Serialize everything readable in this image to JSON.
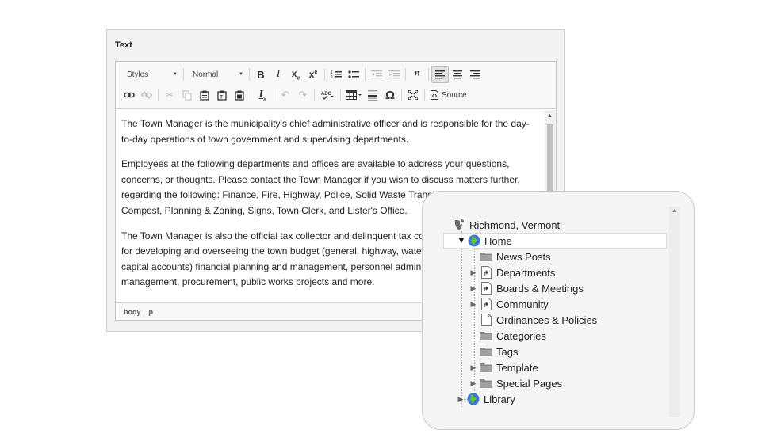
{
  "panel": {
    "label": "Text"
  },
  "toolbar": {
    "styles_label": "Styles",
    "format_label": "Normal",
    "source_label": "Source",
    "row1": [
      "bold-button",
      "italic-button",
      "subscript-button",
      "superscript-button",
      "numbered-list-button",
      "bulleted-list-button",
      "decrease-indent-button",
      "increase-indent-button",
      "blockquote-button",
      "align-left-button",
      "align-center-button",
      "align-right-button"
    ],
    "row2": [
      "link-button",
      "unlink-button",
      "cut-button",
      "copy-button",
      "paste-button",
      "paste-text-button",
      "paste-word-button",
      "remove-format-button",
      "undo-button",
      "redo-button",
      "spellcheck-button",
      "table-button",
      "horizontal-rule-button",
      "special-char-button",
      "maximize-button",
      "source-button"
    ]
  },
  "content": {
    "paragraphs": [
      "The Town Manager is the municipality's chief administrative officer and is responsible for the day-to-day operations of town government and supervising departments.",
      "Employees at the following departments and offices are available to address your questions, concerns, or thoughts. Please contact the Town Manager if you wish to discuss matters further, regarding the following: Finance, Fire, Highway, Police, Solid Waste Transfer Station, Wastewater, Compost, Planning & Zoning, Signs, Town Clerk, and Lister's Office.",
      "The Town Manager is also the official tax collector and delinquent tax collector and is responsible for developing and overseeing the town budget (general, highway, water, wastewater, and all capital accounts) financial planning and management, personnel administration, facility management, procurement, public works projects and more."
    ]
  },
  "statusbar": {
    "path": [
      "body",
      "p"
    ]
  },
  "pagetree": {
    "root": "Richmond, Vermont",
    "home": "Home",
    "children": [
      {
        "label": "News Posts",
        "expandable": false,
        "icon": "folder-icon"
      },
      {
        "label": "Departments",
        "expandable": true,
        "icon": "shortcut-page-icon"
      },
      {
        "label": "Boards & Meetings",
        "expandable": true,
        "icon": "shortcut-page-icon"
      },
      {
        "label": "Community",
        "expandable": true,
        "icon": "shortcut-page-icon"
      },
      {
        "label": "Ordinances & Policies",
        "expandable": false,
        "icon": "page-icon"
      },
      {
        "label": "Categories",
        "expandable": false,
        "icon": "folder-icon"
      },
      {
        "label": "Tags",
        "expandable": false,
        "icon": "folder-icon"
      },
      {
        "label": "Template",
        "expandable": true,
        "icon": "folder-icon"
      },
      {
        "label": "Special Pages",
        "expandable": true,
        "icon": "folder-icon"
      }
    ],
    "library": "Library"
  },
  "colors": {
    "globe_blue": "#3a7bd5",
    "globe_green": "#6bbf3a",
    "folder_gray": "#8a8a8a"
  }
}
